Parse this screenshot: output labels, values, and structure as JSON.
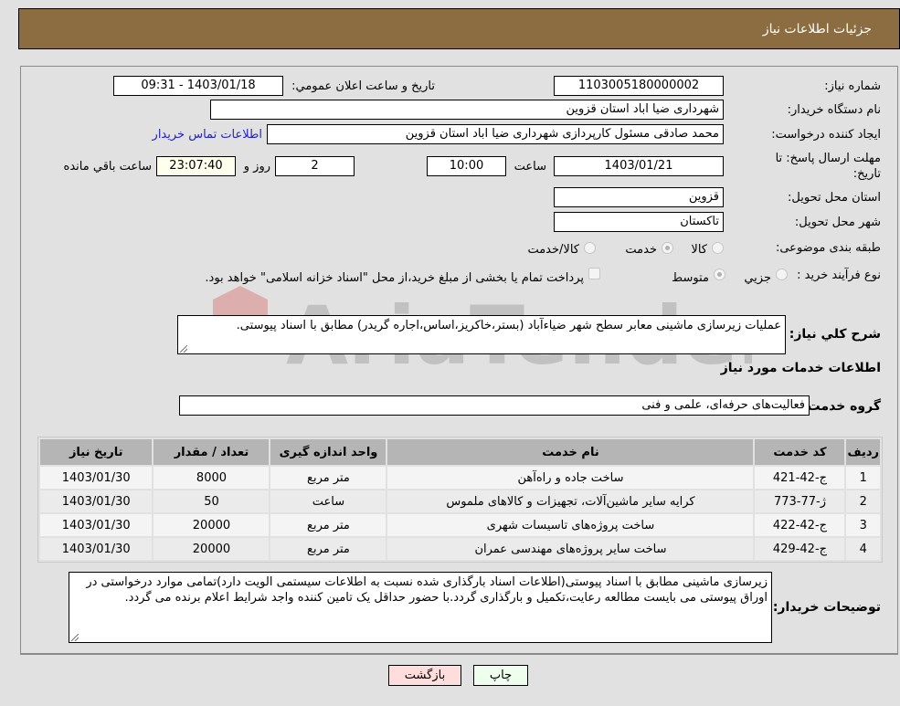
{
  "header": {
    "title": "جزئیات اطلاعات نیاز"
  },
  "form": {
    "need_number": {
      "label": "شماره نیاز:",
      "value": "1103005180000002"
    },
    "announce_datetime": {
      "label": "تاریخ و ساعت اعلان عمومي:",
      "value": "1403/01/18 - 09:31"
    },
    "buyer_org": {
      "label": "نام دستگاه خريدار:",
      "value": "شهرداری ضیا اباد استان قزوین"
    },
    "requester": {
      "label": "ایجاد کننده درخواست:",
      "value": "محمد صادقی مسئول کارپردازی شهرداری ضیا اباد استان قزوین",
      "contact_link": "اطلاعات تماس خریدار"
    },
    "deadline": {
      "label": "مهلت ارسال پاسخ: تا تاریخ:",
      "date": "1403/01/21",
      "time_label": "ساعت",
      "time": "10:00",
      "days": "2",
      "days_label": "روز و",
      "remaining": "23:07:40",
      "remaining_label": "ساعت باقي مانده"
    },
    "delivery_province": {
      "label": "استان محل تحویل:",
      "value": "قزوین"
    },
    "delivery_city": {
      "label": "شهر محل تحویل:",
      "value": "تاکستان"
    },
    "category": {
      "label": "طبقه بندی موضوعی:",
      "options": [
        "کالا",
        "خدمت",
        "کالا/خدمت"
      ],
      "selected": "خدمت"
    },
    "purchase_type": {
      "label": "نوع فرآیند خرید :",
      "options": [
        "جزيي",
        "متوسط"
      ],
      "selected": "متوسط",
      "treasury_checkbox_label": "پرداخت تمام یا بخشی از مبلغ خرید،از محل \"اسناد خزانه اسلامی\" خواهد بود.",
      "treasury_checked": false
    },
    "description": {
      "label": "شرح کلي نياز:",
      "value": "عملیات زیرسازی ماشینی معابر سطح شهر ضیاءآباد (بستر،خاکریز،اساس،اجاره گریدر) مطابق با اسناد پیوستی."
    }
  },
  "services_section": {
    "title": "اطلاعات خدمات مورد نياز",
    "group_label": "گروه خدمت:",
    "group_value": "فعالیت‌های حرفه‌ای، علمی و فنی",
    "table": {
      "headers": [
        "ردیف",
        "کد خدمت",
        "نام خدمت",
        "واحد اندازه گیری",
        "تعداد / مقدار",
        "تاریخ نیاز"
      ],
      "rows": [
        [
          "1",
          "ج-42-421",
          "ساخت جاده و راه‌آهن",
          "متر مربع",
          "8000",
          "1403/01/30"
        ],
        [
          "2",
          "ژ-77-773",
          "کرایه سایر ماشین‌آلات، تجهیزات و کالاهای ملموس",
          "ساعت",
          "50",
          "1403/01/30"
        ],
        [
          "3",
          "ج-42-422",
          "ساخت پروژه‌های تاسیسات شهری",
          "متر مربع",
          "20000",
          "1403/01/30"
        ],
        [
          "4",
          "ج-42-429",
          "ساخت سایر پروژه‌های مهندسی عمران",
          "متر مربع",
          "20000",
          "1403/01/30"
        ]
      ]
    }
  },
  "buyer_notes": {
    "label": "توضیحات خریدار:",
    "value": "زیرسازی ماشینی مطابق با اسناد پیوستی(اطلاعات اسناد بارگذاری شده نسبت به اطلاعات سیستمی الویت دارد)تمامی موارد درخواستی در اوراق پیوستی می بایست مطالعه رعایت،تکمیل و بارگذاری گردد.با حضور حداقل یک تامین کننده واجد شرایط اعلام برنده می گردد."
  },
  "buttons": {
    "print": "چاپ",
    "back": "بازگشت"
  },
  "colors": {
    "header_bg": "#8c6c41",
    "print_bg": "#eeffee",
    "back_bg": "#ffdddd",
    "link": "#2222cc"
  },
  "watermark": {
    "text": "AriaTender.neT"
  }
}
